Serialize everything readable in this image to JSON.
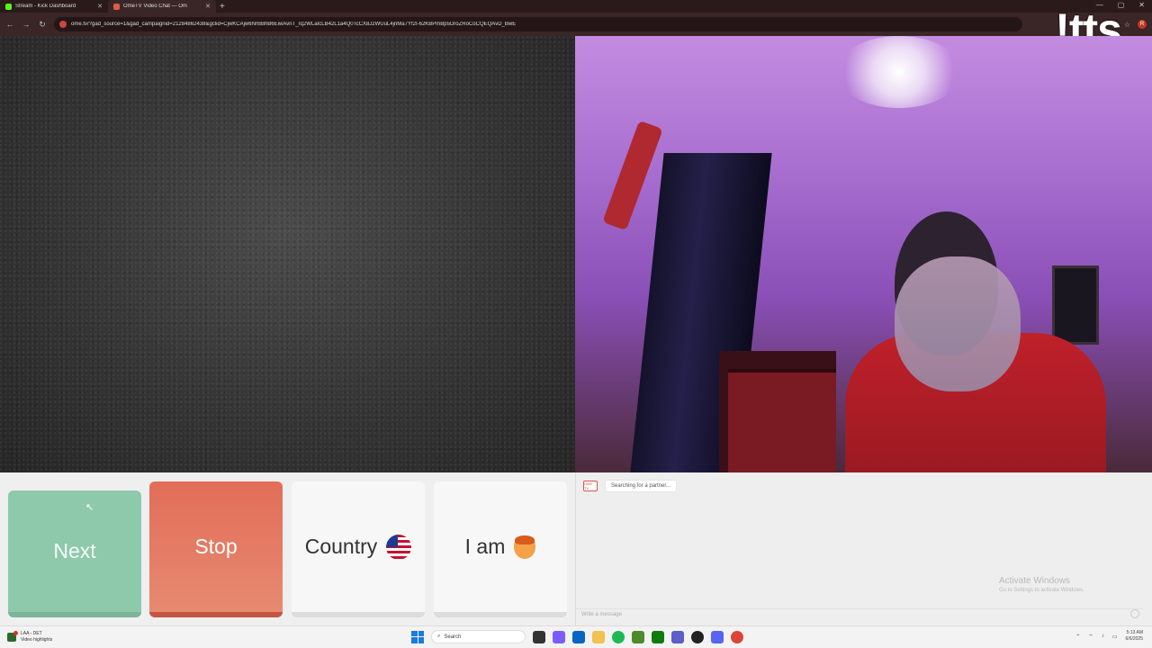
{
  "browser": {
    "tabs": [
      {
        "title": "Stream - Kick Dashboard",
        "color": "#53fc18",
        "active": false
      },
      {
        "title": "OmeTV Video Chat — Om",
        "color": "#e05a4a",
        "active": true
      }
    ],
    "url": "ome.tv/?gad_source=1&gad_campaignid=21284862438&gclid=CjwKCAjw6NrBBhB6EiwAvnT_rq2WLaIcLB42L1a4Q0TcCX8J2WUuL4jnMa7Yf2I-62KBPmBp5DroZRoCoCQEQAvD_BwE"
  },
  "overlay": {
    "logo_text": "!tts"
  },
  "controls": {
    "next_label": "Next",
    "stop_label": "Stop",
    "country_label": "Country",
    "iam_label": "I am"
  },
  "chat": {
    "status_message": "Searching for a partner...",
    "logo_label": "OME TV",
    "input_placeholder": "Write a message"
  },
  "watermark": {
    "title": "Activate Windows",
    "subtitle": "Go to Settings to activate Windows."
  },
  "taskbar": {
    "weather_line1": "LAA - DET",
    "weather_line2": "Video highlights",
    "search_placeholder": "Search",
    "time": "5:13 AM",
    "date": "6/6/2025"
  },
  "colors": {
    "next": "#8ec9ac",
    "stop": "#e26d58",
    "accent": "#1c7ae0"
  }
}
